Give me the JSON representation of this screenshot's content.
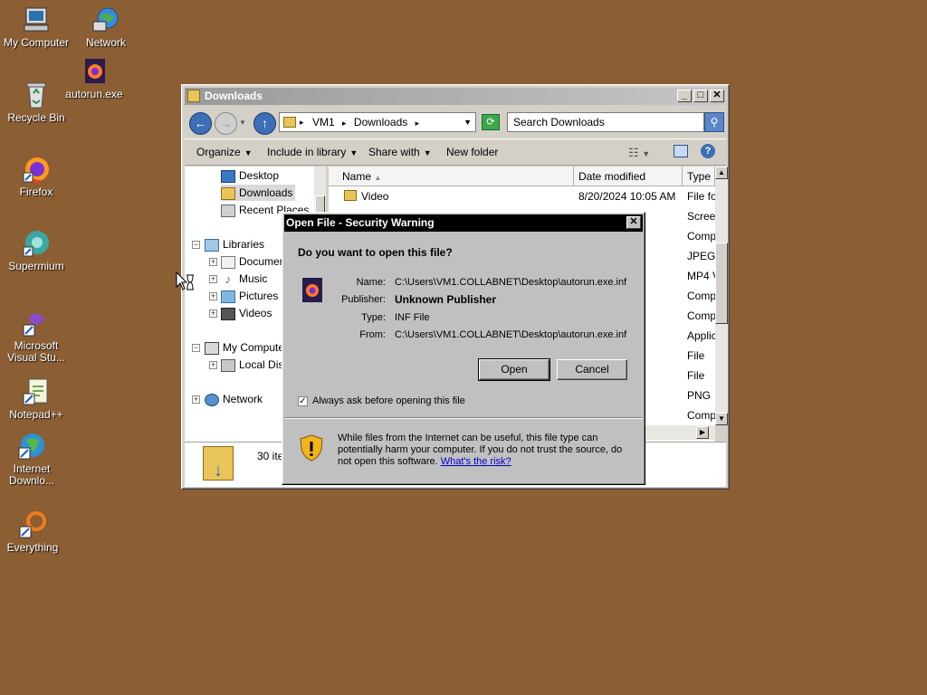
{
  "desktop": {
    "icons": [
      {
        "label": "My Computer",
        "icon": "my-computer-icon"
      },
      {
        "label": "Network",
        "icon": "network-icon"
      },
      {
        "label": "autorun.exe",
        "icon": "firefox-file-icon"
      },
      {
        "label": "Recycle Bin",
        "icon": "recycle-bin-icon"
      },
      {
        "label": "Firefox",
        "icon": "firefox-icon"
      },
      {
        "label": "Supermium",
        "icon": "supermium-icon"
      },
      {
        "label": "Microsoft Visual Stu...",
        "icon": "visual-studio-icon"
      },
      {
        "label": "Notepad++",
        "icon": "notepad-plus-plus-icon"
      },
      {
        "label": "Internet Downlo...",
        "icon": "internet-download-manager-icon"
      },
      {
        "label": "Everything",
        "icon": "everything-search-icon"
      }
    ],
    "background_color": "#8b5e34"
  },
  "explorer": {
    "title": "Downloads",
    "address": {
      "segments": [
        "VM1",
        "Downloads"
      ],
      "separator": "▸"
    },
    "search_placeholder": "Search Downloads",
    "commands": {
      "organize": "Organize",
      "include_in_library": "Include in library",
      "share_with": "Share with",
      "new_folder": "New folder"
    },
    "nav": {
      "desktop": "Desktop",
      "downloads": "Downloads",
      "recent_places": "Recent Places",
      "libraries": "Libraries",
      "documents": "Documer",
      "music": "Music",
      "pictures": "Pictures",
      "videos": "Videos",
      "my_computer": "My Computer",
      "local_disk": "Local Dis",
      "network": "Network"
    },
    "columns": {
      "name": "Name",
      "date_modified": "Date modified",
      "type": "Type"
    },
    "files": [
      {
        "name": "Video",
        "date": "8/20/2024 10:05 AM",
        "type": "File fo"
      },
      {
        "name": "",
        "date": "46 AM",
        "type": "Scree"
      },
      {
        "name": "",
        "date": "46 AM",
        "type": "Comp"
      },
      {
        "name": "",
        "date": "19 AM",
        "type": "JPEG"
      },
      {
        "name": "",
        "date": "4 AM",
        "type": "MP4 V"
      },
      {
        "name": "",
        "date": "12 AM",
        "type": "Comp"
      },
      {
        "name": "",
        "date": "11 AM",
        "type": "Comp"
      },
      {
        "name": "",
        "date": "01 AM",
        "type": "Applic"
      },
      {
        "name": "",
        "date": "32 AM",
        "type": "File"
      },
      {
        "name": "",
        "date": "40 AM",
        "type": "File"
      },
      {
        "name": "",
        "date": "41 AM",
        "type": "PNG"
      },
      {
        "name": "",
        "date": "41 AM",
        "type": "Comp"
      }
    ],
    "item_count": "30 ite"
  },
  "dialog": {
    "title": "Open File - Security Warning",
    "question": "Do you want to open this file?",
    "fields": {
      "name_label": "Name:",
      "name_value": "C:\\Users\\VM1.COLLABNET\\Desktop\\autorun.exe.inf",
      "publisher_label": "Publisher:",
      "publisher_value": "Unknown Publisher",
      "type_label": "Type:",
      "type_value": "INF File",
      "from_label": "From:",
      "from_value": "C:\\Users\\VM1.COLLABNET\\Desktop\\autorun.exe.inf"
    },
    "open_label": "Open",
    "cancel_label": "Cancel",
    "always_ask_label": "Always ask before opening this file",
    "always_ask_checked": true,
    "warning_text": "While files from the Internet can be useful, this file type can potentially harm your computer. If you do not trust the source, do not open this software.",
    "risk_link": "What's the risk?"
  }
}
